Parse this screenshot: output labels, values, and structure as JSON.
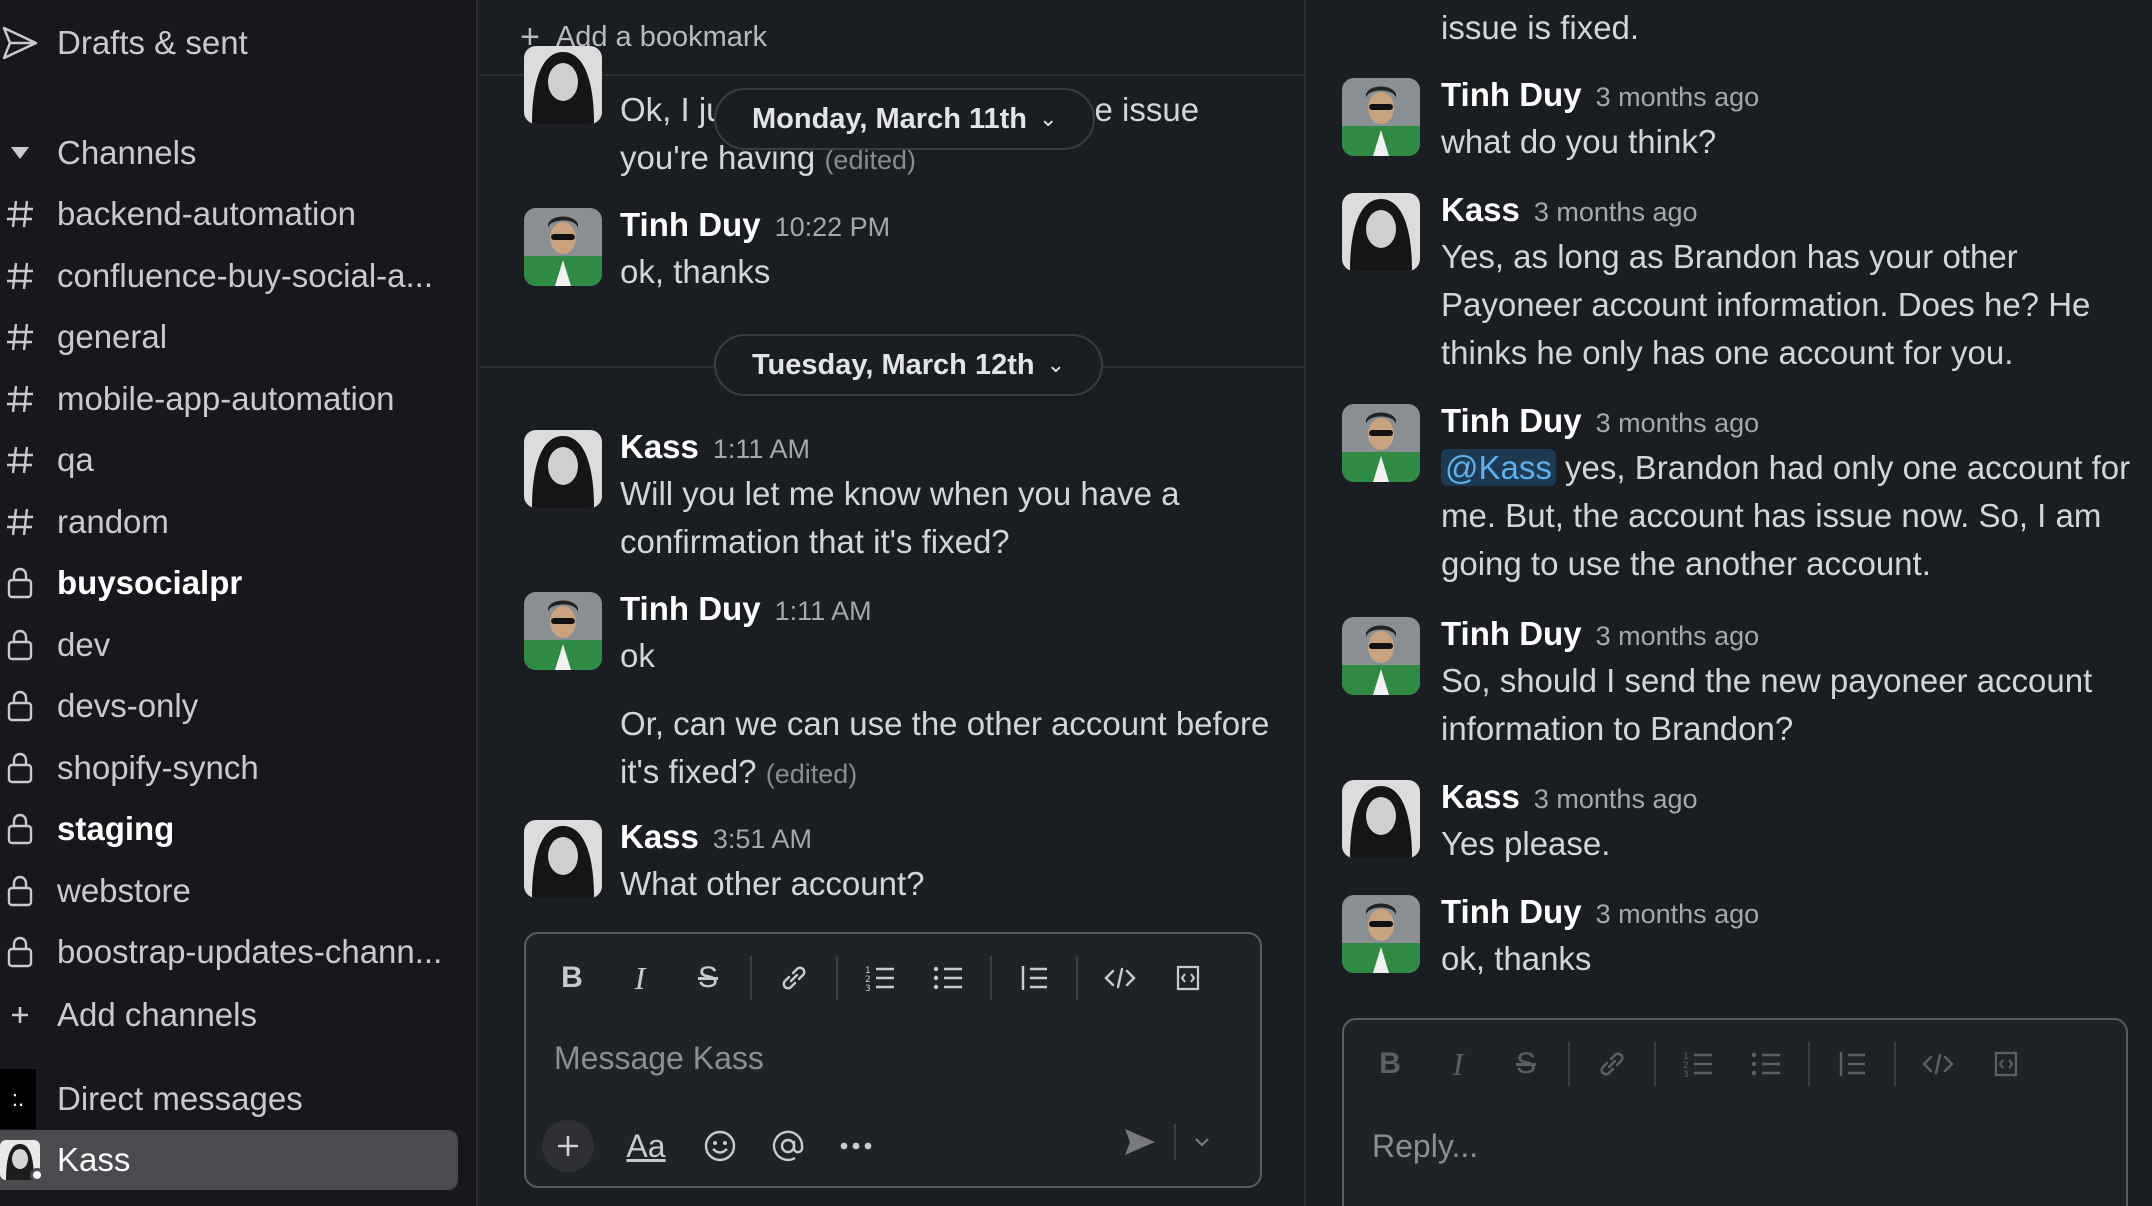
{
  "sidebar": {
    "drafts_label": "Drafts & sent",
    "channels_header": "Channels",
    "channels": [
      {
        "label": "backend-automation",
        "type": "public",
        "bold": false
      },
      {
        "label": "confluence-buy-social-a...",
        "type": "public",
        "bold": false
      },
      {
        "label": "general",
        "type": "public",
        "bold": false
      },
      {
        "label": "mobile-app-automation",
        "type": "public",
        "bold": false
      },
      {
        "label": "qa",
        "type": "public",
        "bold": false
      },
      {
        "label": "random",
        "type": "public",
        "bold": false
      },
      {
        "label": "buysocialpr",
        "type": "private",
        "bold": true
      },
      {
        "label": "dev",
        "type": "private",
        "bold": false
      },
      {
        "label": "devs-only",
        "type": "private",
        "bold": false
      },
      {
        "label": "shopify-synch",
        "type": "private",
        "bold": false
      },
      {
        "label": "staging",
        "type": "private",
        "bold": true
      },
      {
        "label": "webstore",
        "type": "private",
        "bold": false
      },
      {
        "label": "boostrap-updates-chann...",
        "type": "private",
        "bold": false
      }
    ],
    "add_channels_label": "Add channels",
    "dm_header": "Direct messages",
    "dm_selected": "Kass"
  },
  "channel": {
    "bookmark_label": "Add a bookmark",
    "partial_msg_line1_a": "Ok, I ju",
    "partial_msg_line1_b": "the issue",
    "partial_msg_line2": "you're having",
    "edited_label": "(edited)",
    "date_pill_1": "Monday, March 11th",
    "date_pill_2": "Tuesday, March 12th",
    "messages": [
      {
        "name": "Tinh Duy",
        "time": "10:22 PM",
        "text": "ok, thanks"
      },
      {
        "name": "Kass",
        "time": "1:11 AM",
        "text": "Will you let me know when you have a confirmation that it's fixed?"
      },
      {
        "name": "Tinh Duy",
        "time": "1:11 AM",
        "text": "ok"
      },
      {
        "text": "Or, can we can use the other account before it's fixed?"
      },
      {
        "name": "Kass",
        "time": "3:51 AM",
        "text": "What other account?"
      }
    ],
    "composer_placeholder": "Message Kass"
  },
  "thread": {
    "top_partial_text": "issue is fixed.",
    "messages": [
      {
        "name": "Tinh Duy",
        "time": "3 months ago",
        "text": "what do you think?"
      },
      {
        "name": "Kass",
        "time": "3 months ago",
        "text": "Yes, as long as Brandon has your other Payoneer account information. Does he? He thinks he only has one account for you."
      },
      {
        "name": "Tinh Duy",
        "time": "3 months ago",
        "mention": "@Kass",
        "text": "yes, Brandon had only one account for me. But, the account has issue now. So, I am going to use the another account."
      },
      {
        "name": "Tinh Duy",
        "time": "3 months ago",
        "text": "So, should I send the new payoneer account information to Brandon?"
      },
      {
        "name": "Kass",
        "time": "3 months ago",
        "text": "Yes please."
      },
      {
        "name": "Tinh Duy",
        "time": "3 months ago",
        "text": "ok, thanks"
      }
    ],
    "reply_placeholder": "Reply..."
  },
  "icons": {
    "bold": "B",
    "italic": "I",
    "strike": "S",
    "link": "link-icon",
    "ordered_list": "ordered-list-icon",
    "bullet_list": "bullet-list-icon",
    "blockquote": "blockquote-icon",
    "code": "</>",
    "code_block": "code-block-icon",
    "format_text": "Aa"
  },
  "colors": {
    "sidebar_bg": "#19171d",
    "pane_bg": "#1a1d21",
    "mention_bg": "#1d3a52",
    "mention_fg": "#5fb0ea"
  }
}
